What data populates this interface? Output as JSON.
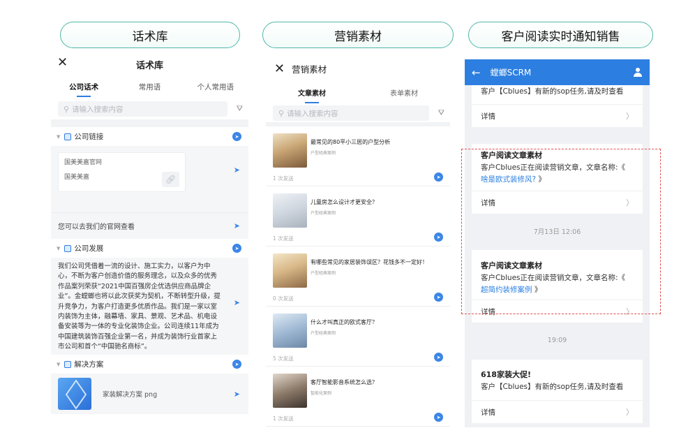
{
  "pills": [
    "话术库",
    "营销素材",
    "客户阅读实时通知销售"
  ],
  "panel1": {
    "title": "话术库",
    "tabs": [
      "公司话术",
      "常用语",
      "个人常用语"
    ],
    "search_placeholder": "请输入搜索内容",
    "sections": {
      "links": "公司链接",
      "development": "公司发展",
      "solutions": "解决方案"
    },
    "link_card": {
      "name": "国美美嘉官网",
      "desc": "国美美嘉"
    },
    "link_tip": "您可以去我们的官网查看",
    "development_text": "我们公司凭借着一流的设计、施工实力，以客户为中心，不断为客户创造价值的服务理念，以及众多的优秀作品案列荣获“2021中国百强房企优选供应商品牌企业”。金螳螂也将以此次获奖为契机，不断转型升级，提升竞争力，为客户打造更多优质作品。我们是一家以室内装饰为主体，融幕墙、家具、景观、艺术品、机电设备安装等为一体的专业化装饰企业。公司连续11年成为中国建筑装饰百强企业第一名，并成为装饰行业首家上市公司和首个“中国驰名商标”。",
    "solution_file": "家装解决方案 png"
  },
  "panel2": {
    "title": "营销素材",
    "tabs": [
      "文章素材",
      "表单素材"
    ],
    "search_placeholder": "请输入搜索内容",
    "articles": [
      {
        "title": "最常见的80平小三居的户型分析",
        "tag": "户型经典案例",
        "count": "1 次发送"
      },
      {
        "title": "儿童房怎么设计才更安全？",
        "tag": "户型经典案例",
        "count": "1 次发送"
      },
      {
        "title": "有哪些常见的家居装饰误区？花钱多不一定好！",
        "tag": "户型经典案例",
        "count": "0 次发送"
      },
      {
        "title": "什么才叫真正的欧式客厅？",
        "tag": "户型经典案例",
        "count": "5 次发送"
      },
      {
        "title": "客厅智能影音系统怎么选？",
        "tag": "智能化案例",
        "count": "1 次发送"
      }
    ]
  },
  "panel3": {
    "app_title": "螳螂SCRM",
    "card1_body": "客户【Cblues】有新的sop任务,请及时查看",
    "detail": "详情",
    "card2": {
      "title": "客户阅读文章素材",
      "body_prefix": "客户Cblues正在阅读营销文章，文章名称:《",
      "article": "啥是欧式装修风?",
      "suffix": "》"
    },
    "stamp1": "7月13日 12:06",
    "card3": {
      "title": "客户阅读文章素材",
      "body_prefix": "客户Cblues正在阅读营销文章，文章名称:《",
      "article": "超简约装修案例",
      "suffix": "》"
    },
    "stamp2": "19:09",
    "card4": {
      "title": "618家装大促!",
      "body": "客户【Cblues】有新的sop任务,请及时查看"
    }
  },
  "colors": {
    "accent": "#2c7fe0",
    "pill_border": "#4fb8a8",
    "highlight_box": "#e05050"
  }
}
